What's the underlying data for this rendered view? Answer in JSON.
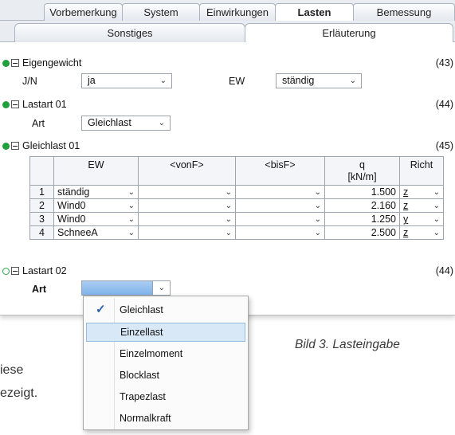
{
  "tabs_row1": [
    "Vorbemerkung",
    "System",
    "Einwirkungen",
    "Lasten",
    "Bemessung"
  ],
  "tabs_row2": [
    "Sonstiges",
    "Erläuterung"
  ],
  "eigengewicht": {
    "title": "Eigengewicht",
    "num": "(43)",
    "label_jn": "J/N",
    "value_jn": "ja",
    "label_ew": "EW",
    "value_ew": "ständig"
  },
  "lastart01": {
    "title": "Lastart 01",
    "num": "(44)",
    "label": "Art",
    "value": "Gleichlast"
  },
  "gleichlast01": {
    "title": "Gleichlast 01",
    "num": "(45)",
    "headers": [
      "EW",
      "<vonF>",
      "<bisF>",
      "q\n[kN/m]",
      "Richt"
    ],
    "rows": [
      {
        "n": "1",
        "ew": "ständig",
        "q": "1.500",
        "r": "z"
      },
      {
        "n": "2",
        "ew": "Wind0",
        "q": "2.160",
        "r": "z"
      },
      {
        "n": "3",
        "ew": "Wind0",
        "q": "1.250",
        "r": "y"
      },
      {
        "n": "4",
        "ew": "SchneeA",
        "q": "2.500",
        "r": "z"
      }
    ]
  },
  "lastart02": {
    "title": "Lastart 02",
    "num": "(44)",
    "label": "Art",
    "value": ""
  },
  "dropdown": {
    "options": [
      "Gleichlast",
      "Einzellast",
      "Einzelmoment",
      "Blocklast",
      "Trapezlast",
      "Normalkraft"
    ],
    "checked": "Gleichlast",
    "highlighted": "Einzellast"
  },
  "caption": "Bild 3. Lasteingabe",
  "body_fragments": [
    "iese",
    "ezeigt."
  ],
  "colors": {
    "accent_green": "#1ea03b",
    "highlight": "#d9e8f7",
    "selected": "#7fb3ea"
  }
}
